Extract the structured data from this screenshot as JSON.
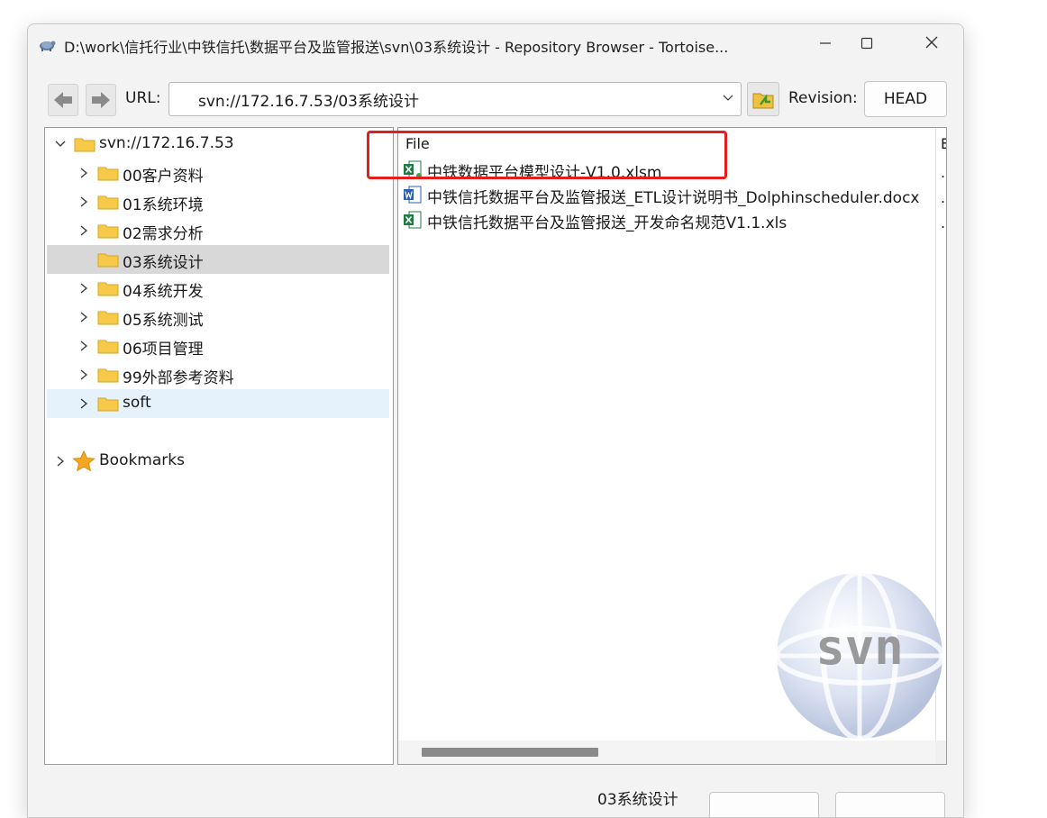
{
  "window": {
    "title": "D:\\work\\信托行业\\中铁信托\\数据平台及监管报送\\svn\\03系统设计 - Repository Browser - Tortoise...",
    "app_icon": "tortoisesvn-icon",
    "controls": {
      "minimize_icon": "minimize-icon",
      "maximize_icon": "maximize-icon",
      "close_icon": "close-icon"
    }
  },
  "toolbar": {
    "back_icon": "arrow-left-icon",
    "forward_icon": "arrow-right-icon",
    "url_label": "URL:",
    "url_value": "svn://172.16.7.53/03系统设计",
    "dropdown_icon": "chevron-down-icon",
    "folder_button_icon": "folder-up-icon",
    "revision_label": "Revision:",
    "revision_value": "HEAD"
  },
  "tree": {
    "root": {
      "label": "svn://172.16.7.53",
      "expanded": true
    },
    "items": [
      {
        "label": "00客户资料",
        "state": "normal"
      },
      {
        "label": "01系统环境",
        "state": "normal"
      },
      {
        "label": "02需求分析",
        "state": "normal"
      },
      {
        "label": "03系统设计",
        "state": "selected"
      },
      {
        "label": "04系统开发",
        "state": "normal"
      },
      {
        "label": "05系统测试",
        "state": "normal"
      },
      {
        "label": "06项目管理",
        "state": "normal"
      },
      {
        "label": "99外部参考资料",
        "state": "normal"
      },
      {
        "label": "soft",
        "state": "hover"
      }
    ],
    "bookmarks": {
      "label": "Bookmarks",
      "icon": "star-icon"
    }
  },
  "files": {
    "column_header": "File",
    "second_column_header": "E",
    "rows": [
      {
        "name": "中铁数据平台模型设计-V1.0.xlsm",
        "icon": "excel-icon",
        "extra": "."
      },
      {
        "name": "中铁信托数据平台及监管报送_ETL设计说明书_Dolphinscheduler.docx",
        "icon": "word-icon",
        "extra": "."
      },
      {
        "name": "中铁信托数据平台及监管报送_开发命名规范V1.1.xls",
        "icon": "excel-icon",
        "extra": "."
      }
    ],
    "hscroll_position": 0.1
  },
  "watermark": {
    "text": "svn"
  },
  "status": {
    "path_text": "03系统设计"
  },
  "colors": {
    "highlight_border": "#e41d1d",
    "selected_row": "#d8d8d8",
    "hover_row": "#e5f1fb",
    "folder": "#f7c948"
  }
}
